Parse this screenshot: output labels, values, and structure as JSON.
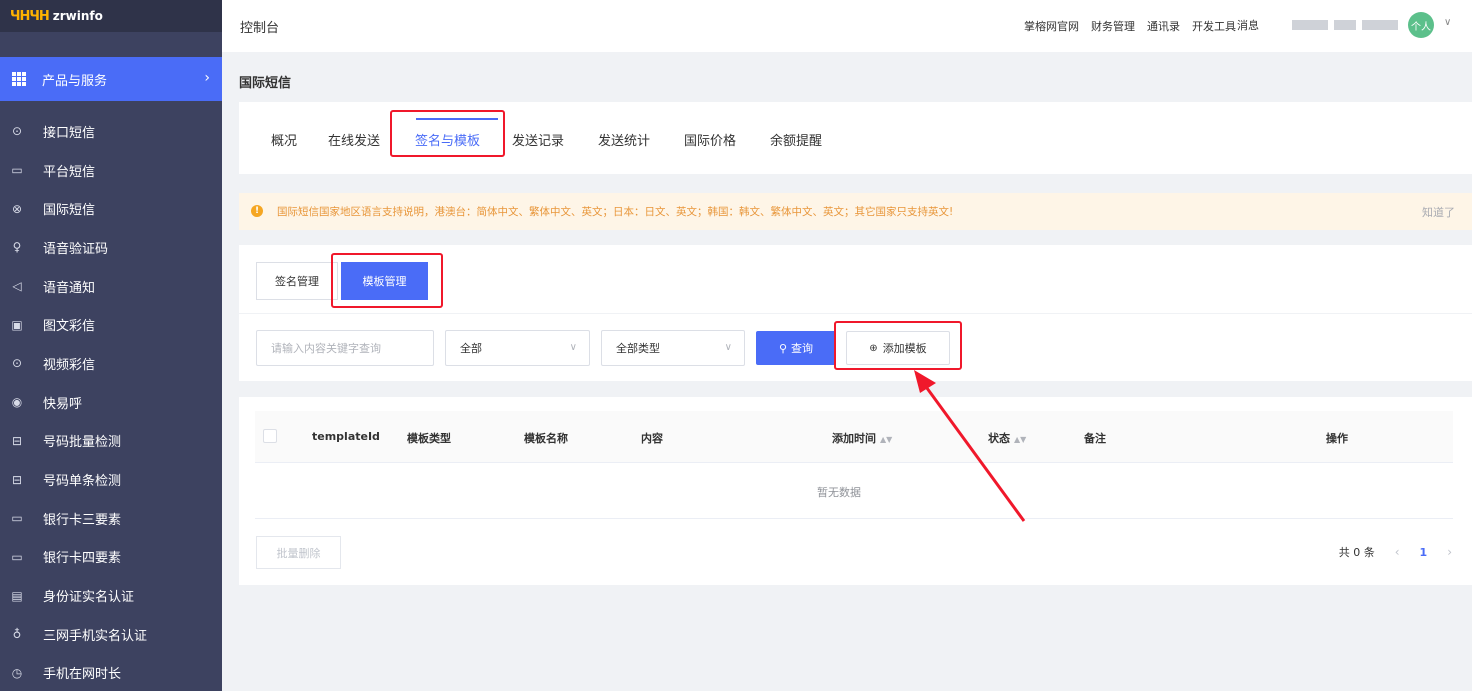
{
  "sidebar": {
    "logo_mark": "ЧНЧН",
    "logo_text": "zrwinfo",
    "product_label": "产品与服务",
    "items": [
      {
        "label": "接口短信",
        "icon": "chat-icon",
        "glyph": "⊙"
      },
      {
        "label": "平台短信",
        "icon": "message-icon",
        "glyph": "▭"
      },
      {
        "label": "国际短信",
        "icon": "globe-icon",
        "glyph": "⊗"
      },
      {
        "label": "语音验证码",
        "icon": "microphone-icon",
        "glyph": "♀"
      },
      {
        "label": "语音通知",
        "icon": "speaker-icon",
        "glyph": "◁"
      },
      {
        "label": "图文彩信",
        "icon": "image-icon",
        "glyph": "▣"
      },
      {
        "label": "视频彩信",
        "icon": "video-icon",
        "glyph": "⊙"
      },
      {
        "label": "快易呼",
        "icon": "phone-circle-icon",
        "glyph": "◉"
      },
      {
        "label": "号码批量检测",
        "icon": "scan-icon",
        "glyph": "⊟"
      },
      {
        "label": "号码单条检测",
        "icon": "scan-icon",
        "glyph": "⊟"
      },
      {
        "label": "银行卡三要素",
        "icon": "card-icon",
        "glyph": "▭"
      },
      {
        "label": "银行卡四要素",
        "icon": "card-icon",
        "glyph": "▭"
      },
      {
        "label": "身份证实名认证",
        "icon": "id-card-icon",
        "glyph": "▤"
      },
      {
        "label": "三网手机实名认证",
        "icon": "users-icon",
        "glyph": "♁"
      },
      {
        "label": "手机在网时长",
        "icon": "clock-icon",
        "glyph": "◷"
      }
    ]
  },
  "header": {
    "title": "控制台",
    "links": [
      "掌榕网官网",
      "财务管理",
      "通讯录",
      "开发工具"
    ],
    "messages": "消息",
    "avatar": "个人"
  },
  "page": {
    "title": "国际短信"
  },
  "tabs": [
    "概况",
    "在线发送",
    "签名与模板",
    "发送记录",
    "发送统计",
    "国际价格",
    "余额提醒"
  ],
  "notice": {
    "text": "国际短信国家地区语言支持说明，港澳台：简体中文、繁体中文、英文；日本：日文、英文；韩国：韩文、繁体中文、英文；其它国家只支持英文!",
    "dismiss": "知道了"
  },
  "subtabs": {
    "signature": "签名管理",
    "template": "模板管理"
  },
  "filter": {
    "search_placeholder": "请输入内容关键字查询",
    "select_all": "全部",
    "select_type": "全部类型",
    "search_button": "查询",
    "add_button": "添加模板"
  },
  "table": {
    "columns": [
      "templateId",
      "模板类型",
      "模板名称",
      "内容",
      "添加时间",
      "状态",
      "备注",
      "操作"
    ],
    "empty_text": "暂无数据",
    "bulk_delete": "批量删除"
  },
  "pager": {
    "total": "共 0 条",
    "current_page": "1"
  },
  "colors": {
    "primary": "#4a6cf7",
    "sidebar": "#3d4260",
    "annotation_red": "#f0182b",
    "notice_bg": "#fef5e7",
    "notice_text": "#e8963a"
  }
}
